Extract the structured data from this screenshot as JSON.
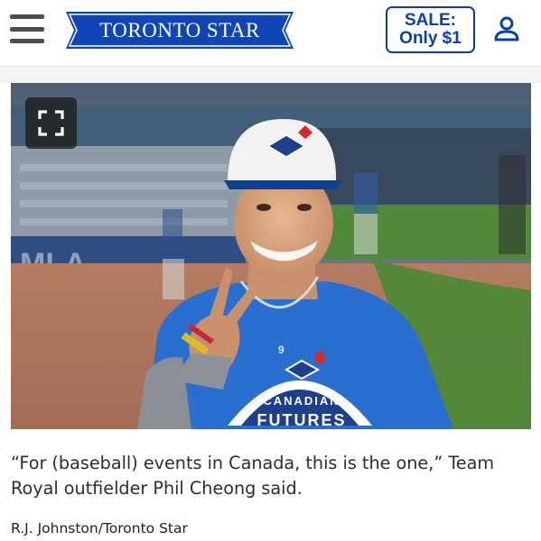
{
  "header": {
    "logo_text": "TORONTO STAR",
    "sale_line1": "SALE:",
    "sale_line2": "Only $1"
  },
  "photo": {
    "jersey_text_line1": "CANADIAN",
    "jersey_text_line2": "FUTURES",
    "jersey_number": "9"
  },
  "caption": "“For (baseball) events in Canada, this is the one,” Team Royal outfielder Phil Cheong said.",
  "credit": "R.J. Johnston/Toronto Star",
  "colors": {
    "brand_blue": "#0d3fa8",
    "jersey_blue": "#2a6fd0"
  }
}
